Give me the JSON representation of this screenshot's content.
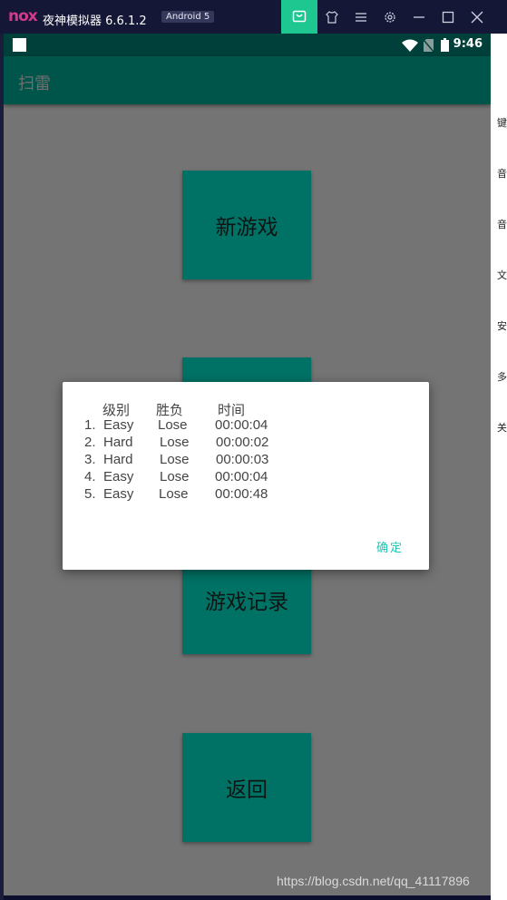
{
  "emulator": {
    "logo": "nox",
    "title": "夜神模拟器 6.6.1.2",
    "android_badge": "Android 5",
    "icons": [
      "store-icon",
      "shirt-icon",
      "menu-icon",
      "settings-icon",
      "minimize-icon",
      "maximize-icon",
      "close-icon"
    ]
  },
  "status_bar": {
    "time": "9:46",
    "icons": [
      "app-square-icon",
      "wifi-icon",
      "no-sim-icon",
      "battery-icon"
    ]
  },
  "app_bar": {
    "title": "扫雷"
  },
  "menu_buttons": {
    "new_game": "新游戏",
    "game_records": "游戏记录",
    "back": "返回"
  },
  "dialog": {
    "headers": [
      "级别",
      "胜负",
      "时间"
    ],
    "rows": [
      {
        "num": "1.",
        "level": "Easy",
        "result": "Lose",
        "time": "00:00:04"
      },
      {
        "num": "2.",
        "level": "Hard",
        "result": "Lose",
        "time": "00:00:02"
      },
      {
        "num": "3.",
        "level": "Hard",
        "result": "Lose",
        "time": "00:00:03"
      },
      {
        "num": "4.",
        "level": "Easy",
        "result": "Lose",
        "time": "00:00:04"
      },
      {
        "num": "5.",
        "level": "Easy",
        "result": "Lose",
        "time": "00:00:48"
      }
    ],
    "ok_label": "确定"
  },
  "side_strip": [
    "键",
    "音",
    "音",
    "文",
    "安",
    "多",
    "关"
  ],
  "watermark": "https://blog.csdn.net/qq_41117896",
  "colors": {
    "titlebar": "#141735",
    "store_accent": "#1ec790",
    "status_bar": "#00403a",
    "app_bar": "#00554b",
    "button": "#007265",
    "dim_background": "#747474",
    "dialog_accent": "#1fc4b2"
  }
}
